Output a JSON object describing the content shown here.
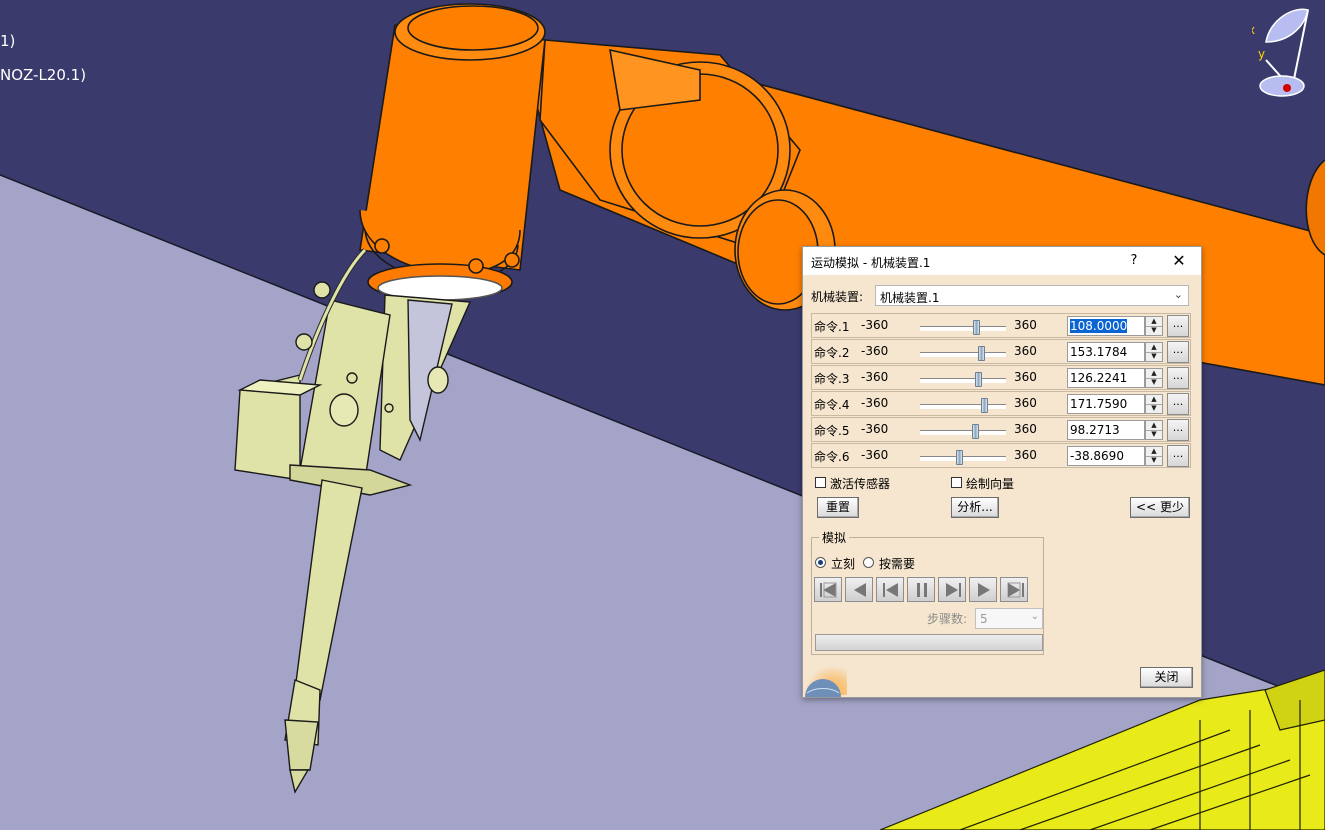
{
  "tree": {
    "line1": "1)",
    "line2": "NOZ-L20.1)"
  },
  "compass": {
    "x_label": "x",
    "y_label": "y"
  },
  "dialog": {
    "title": "运动模拟 - 机械装置.1",
    "help": "?",
    "close_symbol": "✕",
    "mechanism_label": "机械装置:",
    "mechanism_value": "机械装置.1",
    "commands": [
      {
        "name": "命令.1",
        "min": "-360",
        "max": "360",
        "value": "108.0000",
        "position": 0.65
      },
      {
        "name": "命令.2",
        "min": "-360",
        "max": "360",
        "value": "153.1784",
        "position": 0.71
      },
      {
        "name": "命令.3",
        "min": "-360",
        "max": "360",
        "value": "126.2241",
        "position": 0.67
      },
      {
        "name": "命令.4",
        "min": "-360",
        "max": "360",
        "value": "171.7590",
        "position": 0.74
      },
      {
        "name": "命令.5",
        "min": "-360",
        "max": "360",
        "value": "98.2713",
        "position": 0.64
      },
      {
        "name": "命令.6",
        "min": "-360",
        "max": "360",
        "value": "-38.8690",
        "position": 0.45
      }
    ],
    "more_label": "...",
    "activate_sensors": "激活传感器",
    "draw_vectors": "绘制向量",
    "reset": "重置",
    "analyze": "分析...",
    "less": "<< 更少",
    "simulation_group": "模拟",
    "immediate": "立刻",
    "on_request": "按需要",
    "steps_label": "步骤数:",
    "steps_value": "5",
    "close_button": "关闭"
  },
  "colors": {
    "background": "#3a3a6c",
    "floor": "#a4a4c8",
    "robot": "#ff8000",
    "torch": "#e0e3a8",
    "fence": "#e8ea1a",
    "dialog_bg": "#f6e6cf",
    "selection": "#0a64d2"
  }
}
